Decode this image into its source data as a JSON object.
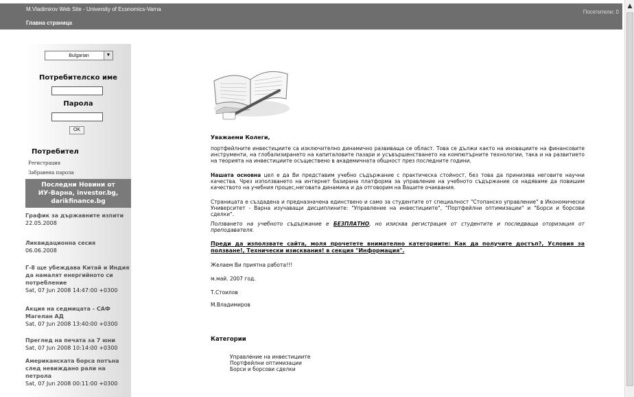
{
  "header": {
    "site_title": "M.Vladimirov Web Site - University of Economics-Varna",
    "nav_home": "Главна страница",
    "visitors": "Посетители: 0"
  },
  "sidebar": {
    "language": "Bulgarian",
    "username_label": "Потребителско име",
    "password_label": "Парола",
    "ok_label": "OK",
    "user_heading": "Потребител",
    "register_link": "Регистрация",
    "forgot_link": "Забравена парола",
    "news_header_line1": "Последни Новини от",
    "news_header_line2": "ИУ-Варна, investor.bg,",
    "news_header_line3": "darikfinance.bg",
    "news": [
      {
        "title_lines": [
          "График за държавните изпити"
        ],
        "date": "22.05.2008"
      },
      {
        "title_lines": [
          "Ликвидационна сесия"
        ],
        "date": "06.06.2008"
      },
      {
        "title_lines": [
          "Г-8 ще убеждава Китай и Индия",
          "да намалят енергийното си",
          "потребление"
        ],
        "date": "Sat, 07 Jun 2008 14:47:00 +0300"
      },
      {
        "title_lines": [
          "Акция на седмицата - САФ",
          "Магелан АД"
        ],
        "date": "Sat, 07 Jun 2008 13:40:00 +0300"
      },
      {
        "title_lines": [
          "Преглед на печата за 7 юни"
        ],
        "date": "Sat, 07 Jun 2008 10:14:00 +0300"
      },
      {
        "title_lines": [
          "Американската борса потъна",
          "след невиждано рали на",
          "петрола"
        ],
        "date": "Sat, 07 Jun 2008 00:11:00 +0300"
      }
    ]
  },
  "main": {
    "greeting": "Уважаеми Колеги,",
    "para1": "портфейлните инвестициите са изключително динамично развиваща се област. Това се дължи както на иновациите на финансовите инструменти, на глобализирането на капиталовите пазари и усъвършенстването на компютърните технологии, така и на развитието на теорията на инвестициите осъществено в академичната общност през последните години.",
    "para2_bold": "Нашата основна",
    "para2_rest": " цел е да Ви представим учебно съдържание с практическа стойност, без това да принизява неговите научни качества. Чрез използването на интернет базирана платформа за управление на учебното съдържание се надяваме да повишим качеството на учебния процес,неговата динамика и да отговорим на Вашите очаквания.",
    "para3": "Страницата е създадена и предназначена единствено и само за студентите от специалност \"Стопанско управление\" в Икономически Университет - Варна изучаващи дисциплините: \"Управление на инвестициите\", \"Портфейлни оптимизации\" и \"Борси и борсови сделки\".",
    "para4_a": "Ползването на учебното съдържание е ",
    "para4_free": "БЕЗПЛАТНО",
    "para4_b": ", но изисква регистрация от студентите и последваща оторизация от преподавателя.",
    "notice": "Преди да използвате сайта, моля прочетете внимателно категориите: Как да получите достъп?, Условия за ползване!, Технически изисквания! в секция \"Информация\".",
    "wish": "Желаем Ви приятна работа!!!",
    "date_line": "м.май. 2007 год.",
    "sign1": "Т.Стоилов",
    "sign2": "М.Владимиров",
    "categories_title": "Категории",
    "categories": [
      "Управление на инвестициите",
      "Портфейлни оптимизации",
      "Борси и борсови сделки"
    ]
  }
}
